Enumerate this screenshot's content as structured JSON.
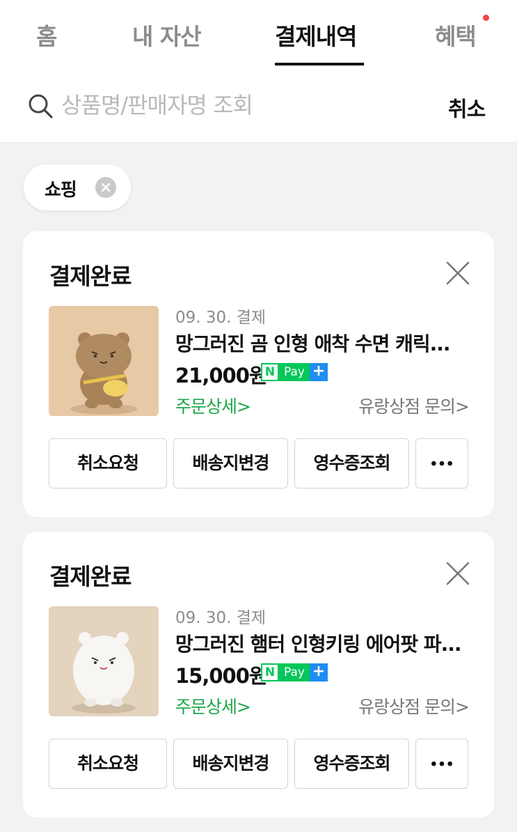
{
  "tabs": [
    {
      "label": "홈",
      "active": false
    },
    {
      "label": "내 자산",
      "active": false
    },
    {
      "label": "결제내역",
      "active": true
    },
    {
      "label": "혜택",
      "active": false,
      "has_new_dot": true
    }
  ],
  "search": {
    "placeholder": "상품명/판매자명 조회",
    "value": "",
    "cancel_label": "취소"
  },
  "filter_chip": {
    "label": "쇼핑"
  },
  "colors": {
    "accent_green": "#1fa74b",
    "npay_green": "#03c75a",
    "npay_blue": "#1f8ef1",
    "dot_red": "#f14646"
  },
  "orders": [
    {
      "status": "결제완료",
      "date": "09. 30. 결제",
      "product_name": "망그러진 곰 인형 애착 수면 캐릭...",
      "price": "21,000원",
      "npay": {
        "n": "N",
        "pay": "Pay",
        "plus": "+"
      },
      "detail_link": "주문상세>",
      "shop_link": "유랑상점 문의>",
      "actions": [
        "취소요청",
        "배송지변경",
        "영수증조회"
      ],
      "thumbnail": "brown-bear-plush"
    },
    {
      "status": "결제완료",
      "date": "09. 30. 결제",
      "product_name": "망그러진 햄터 인형키링 에어팟 파...",
      "price": "15,000원",
      "npay": {
        "n": "N",
        "pay": "Pay",
        "plus": "+"
      },
      "detail_link": "주문상세>",
      "shop_link": "유랑상점 문의>",
      "actions": [
        "취소요청",
        "배송지변경",
        "영수증조회"
      ],
      "thumbnail": "white-hamster-plush"
    }
  ]
}
